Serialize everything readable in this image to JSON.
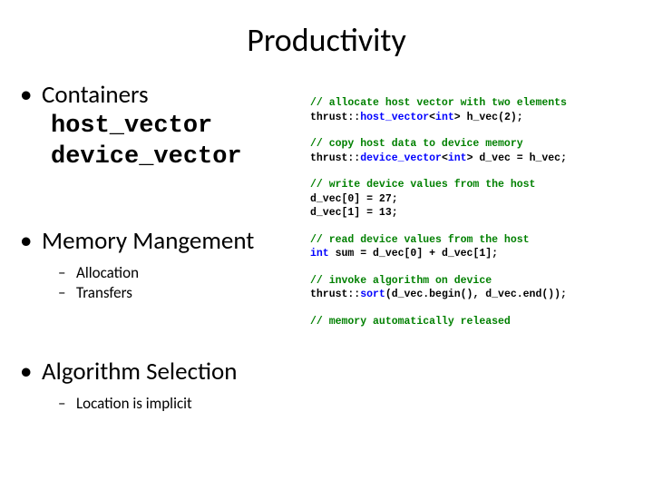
{
  "title": "Productivity",
  "left": {
    "bullets": [
      {
        "text": "Containers",
        "mono": [
          "host_vector",
          "device_vector"
        ],
        "subs": []
      },
      {
        "text": "Memory Mangement",
        "mono": [],
        "subs": [
          "Allocation",
          "Transfers"
        ]
      },
      {
        "text": "Algorithm Selection",
        "mono": [],
        "subs": [
          "Location is implicit"
        ]
      }
    ]
  },
  "code": {
    "b1c": "// allocate host vector with two elements",
    "b1l": [
      "thrust::",
      "host_vector",
      "<",
      "int",
      "> h_vec(2);"
    ],
    "b2c": "// copy host data to device memory",
    "b2l": [
      "thrust::",
      "device_vector",
      "<",
      "int",
      "> d_vec = h_vec;"
    ],
    "b3c": "// write device values from the host",
    "b3l1": "d_vec[0] = 27;",
    "b3l2": "d_vec[1] = 13;",
    "b4c": "// read device values from the host",
    "b4l": [
      "int",
      " sum = d_vec[0] + d_vec[1];"
    ],
    "b5c": "// invoke algorithm on device",
    "b5l": [
      "thrust::",
      "sort",
      "(d_vec.begin(), d_vec.end());"
    ],
    "b6c": "// memory automatically released"
  }
}
